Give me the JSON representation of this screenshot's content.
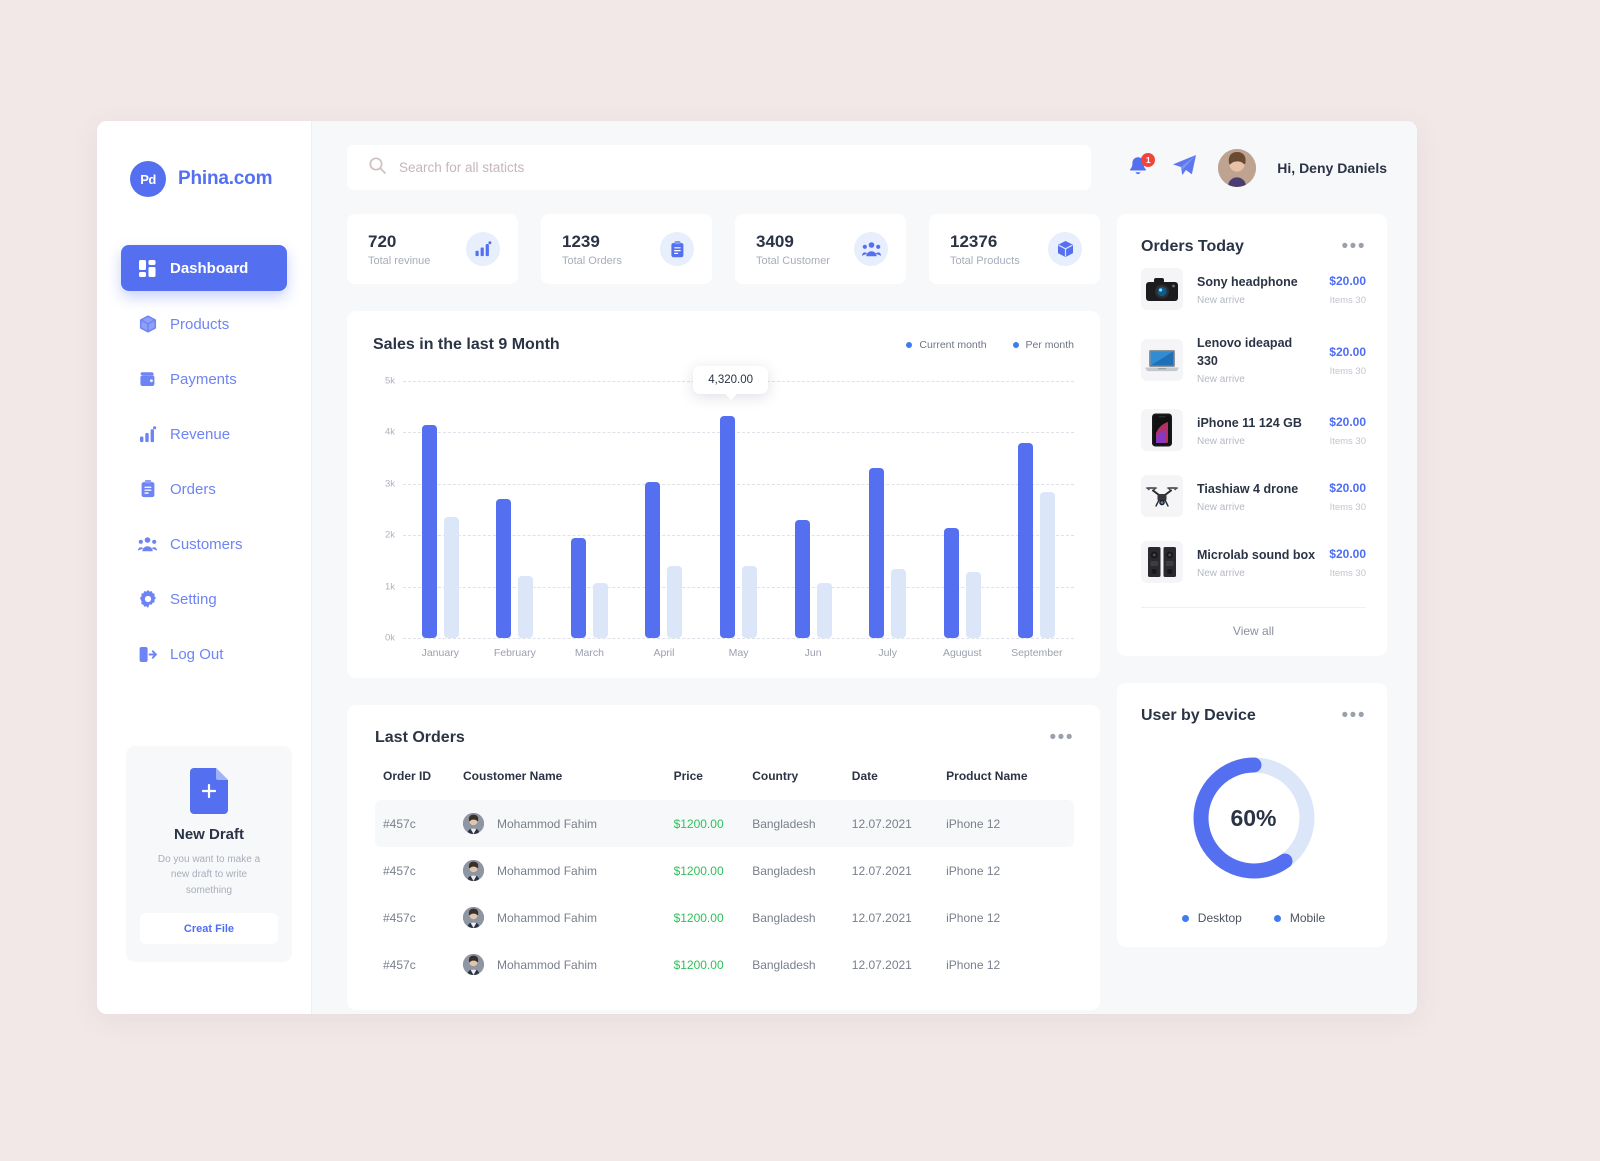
{
  "brand": {
    "logo_text": "Pd",
    "name": "Phina.com",
    "logo_icon": "brand-monogram"
  },
  "sidebar": {
    "items": [
      {
        "label": "Dashboard",
        "icon": "grid-icon",
        "active": true
      },
      {
        "label": "Products",
        "icon": "box-icon",
        "active": false
      },
      {
        "label": "Payments",
        "icon": "wallet-icon",
        "active": false
      },
      {
        "label": "Revenue",
        "icon": "bar-chart-icon",
        "active": false
      },
      {
        "label": "Orders",
        "icon": "clipboard-icon",
        "active": false
      },
      {
        "label": "Customers",
        "icon": "users-icon",
        "active": false
      },
      {
        "label": "Setting",
        "icon": "gear-icon",
        "active": false
      },
      {
        "label": "Log Out",
        "icon": "logout-icon",
        "active": false
      }
    ],
    "draft": {
      "icon": "document-plus-icon",
      "title": "New Draft",
      "description": "Do you want to make a new  draft to write something",
      "button_label": "Creat File"
    }
  },
  "topbar": {
    "search": {
      "placeholder": "Search for all staticts",
      "value": "",
      "icon": "search-icon"
    },
    "notification": {
      "icon": "bell-icon",
      "count": "1"
    },
    "message": {
      "icon": "send-plane-icon"
    },
    "avatar": {
      "icon": "user-avatar"
    },
    "greeting": "Hi, Deny Daniels"
  },
  "stats": [
    {
      "value": "720",
      "label": "Total revinue",
      "icon": "bar-chart-icon"
    },
    {
      "value": "1239",
      "label": "Total Orders",
      "icon": "clipboard-icon"
    },
    {
      "value": "3409",
      "label": "Total Customer",
      "icon": "users-icon"
    },
    {
      "value": "12376",
      "label": "Total Products",
      "icon": "box-icon"
    }
  ],
  "chart_data": {
    "type": "bar",
    "title": "Sales in the last 9 Month",
    "xlabel": "",
    "ylabel": "",
    "ylim": [
      0,
      5000
    ],
    "yticks": [
      "0k",
      "1k",
      "2k",
      "3k",
      "4k",
      "5k"
    ],
    "grid": true,
    "legend_position": "top-right",
    "categories": [
      "January",
      "February",
      "March",
      "April",
      "May",
      "Jun",
      "July",
      "Agugust",
      "September"
    ],
    "series": [
      {
        "name": "Current month",
        "color": "#5470F0",
        "values": [
          4150,
          2700,
          1950,
          3030,
          4320,
          2300,
          3300,
          2150,
          3800
        ]
      },
      {
        "name": "Per month",
        "color": "#DCE6F9",
        "values": [
          2350,
          1200,
          1070,
          1400,
          1400,
          1080,
          1350,
          1280,
          2850
        ]
      }
    ],
    "annotation": {
      "text": "4,320.00",
      "category": "May",
      "series": "Current month"
    }
  },
  "last_orders": {
    "title": "Last Orders",
    "menu_icon": "ellipsis-icon",
    "columns": [
      "Order ID",
      "Coustomer Name",
      "Price",
      "Country",
      "Date",
      "Product Name"
    ],
    "rows": [
      {
        "id": "#457c",
        "customer": "Mohammod Fahim",
        "price": "$1200.00",
        "country": "Bangladesh",
        "date": "12.07.2021",
        "product": "iPhone 12",
        "highlight": true
      },
      {
        "id": "#457c",
        "customer": "Mohammod Fahim",
        "price": "$1200.00",
        "country": "Bangladesh",
        "date": "12.07.2021",
        "product": "iPhone 12",
        "highlight": false
      },
      {
        "id": "#457c",
        "customer": "Mohammod Fahim",
        "price": "$1200.00",
        "country": "Bangladesh",
        "date": "12.07.2021",
        "product": "iPhone 12",
        "highlight": false
      },
      {
        "id": "#457c",
        "customer": "Mohammod Fahim",
        "price": "$1200.00",
        "country": "Bangladesh",
        "date": "12.07.2021",
        "product": "iPhone 12",
        "highlight": false
      }
    ]
  },
  "orders_today": {
    "title": "Orders Today",
    "menu_icon": "ellipsis-icon",
    "view_all_label": "View all",
    "items": [
      {
        "name": "Sony headphone",
        "sub": "New arrive",
        "price": "$20.00",
        "items": "Items 30",
        "icon": "camera-icon"
      },
      {
        "name": "Lenovo ideapad 330",
        "sub": "New arrive",
        "price": "$20.00",
        "items": "Items 30",
        "icon": "laptop-icon"
      },
      {
        "name": "iPhone 11 124 GB",
        "sub": "New arrive",
        "price": "$20.00",
        "items": "Items 30",
        "icon": "phone-icon"
      },
      {
        "name": "Tiashiaw 4 drone",
        "sub": "New arrive",
        "price": "$20.00",
        "items": "Items 30",
        "icon": "drone-icon"
      },
      {
        "name": "Microlab sound box",
        "sub": "New arrive",
        "price": "$20.00",
        "items": "Items 30",
        "icon": "speaker-icon"
      }
    ]
  },
  "user_by_device": {
    "title": "User by Device",
    "menu_icon": "ellipsis-icon",
    "chart_data": {
      "type": "pie",
      "title": "User by Device",
      "center_label": "60%",
      "categories": [
        "Desktop",
        "Mobile"
      ],
      "values": [
        40,
        60
      ],
      "colors": [
        "#DCE6F9",
        "#5470F0"
      ],
      "legend_position": "bottom"
    }
  },
  "colors": {
    "primary": "#5470F0",
    "primary_light": "#DCE6F9",
    "page_bg": "#F2E8E8",
    "panel_bg": "#F7F8FA",
    "success": "#2FC05C",
    "danger": "#F0443C",
    "text": "#2B3445",
    "muted": "#A7ADBB"
  }
}
